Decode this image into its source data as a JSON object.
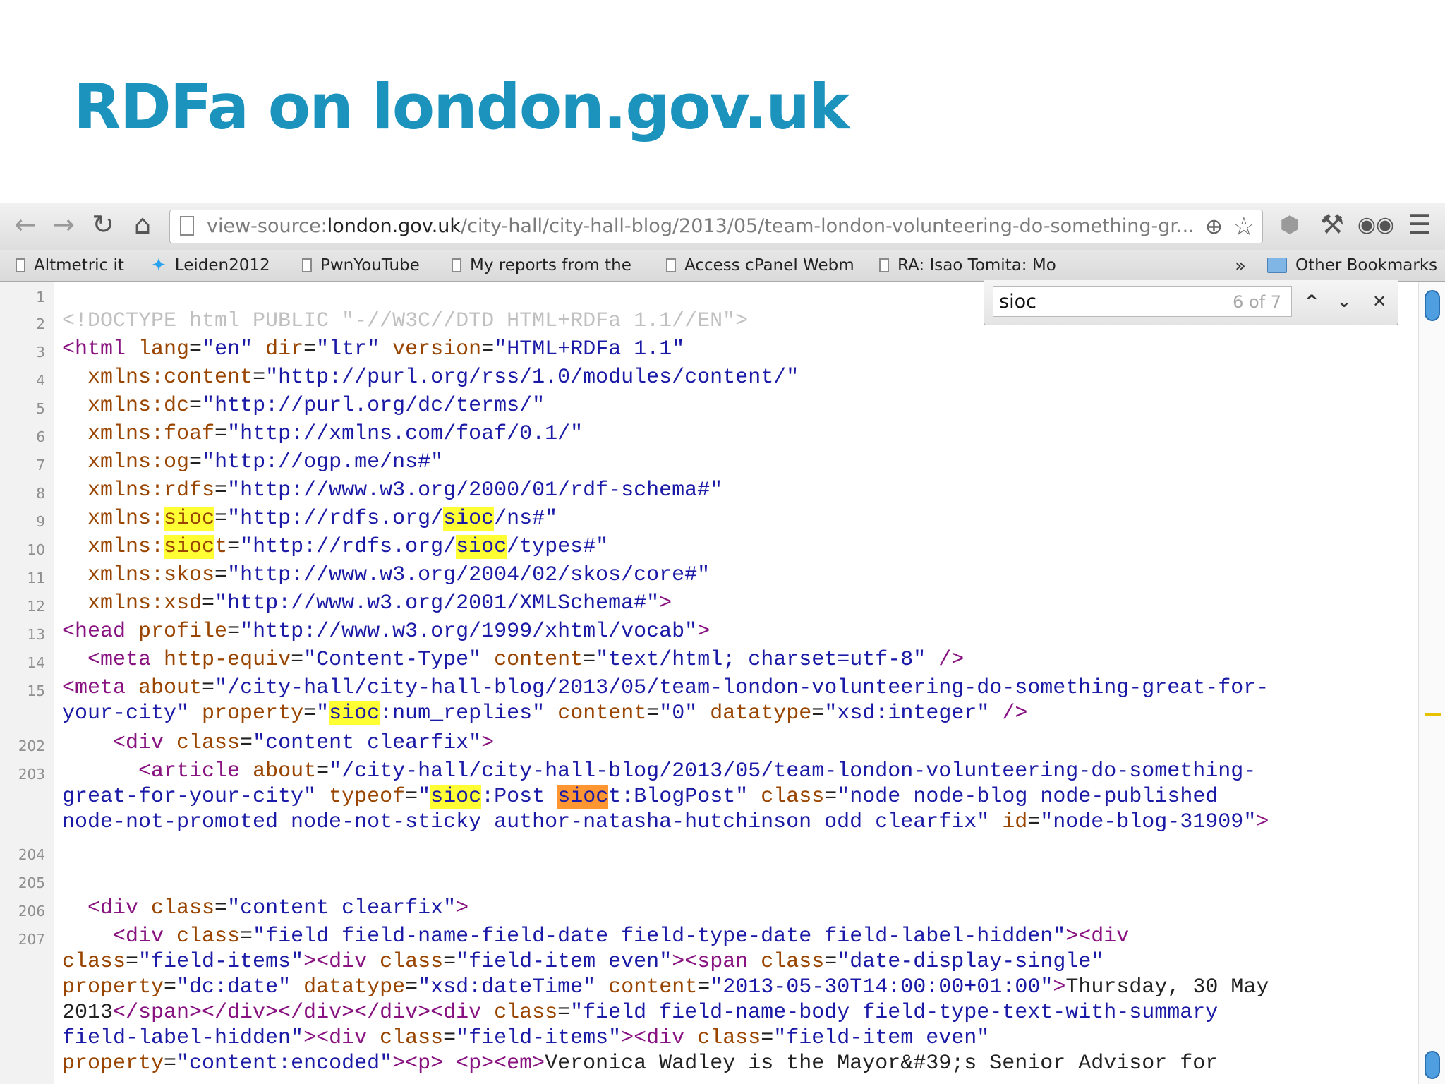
{
  "slide": {
    "title": "RDFa on london.gov.uk"
  },
  "toolbar": {
    "url_prefix": "view-source:",
    "url_host": "london.gov.uk",
    "url_path": "/city-hall/city-hall-blog/2013/05/team-london-volunteering-do-something-gr...",
    "icons": [
      "back-icon",
      "forward-icon",
      "reload-icon",
      "home-icon",
      "page-icon",
      "zoom-icon",
      "star-icon",
      "extension-icon",
      "wrench-icon",
      "incognito-icon",
      "menu-icon"
    ]
  },
  "bookmarks": {
    "items": [
      {
        "label": "Altmetric it",
        "icon": "page-icon"
      },
      {
        "label": "Leiden2012",
        "icon": "twitter-bird-icon"
      },
      {
        "label": "PwnYouTube",
        "icon": "page-icon"
      },
      {
        "label": "My reports from the",
        "icon": "page-icon"
      },
      {
        "label": "Access cPanel Webm",
        "icon": "page-icon"
      },
      {
        "label": "RA: Isao Tomita: Mo",
        "icon": "page-icon"
      }
    ],
    "overflow": "»",
    "other": "Other Bookmarks"
  },
  "find": {
    "query": "sioc",
    "count": "6 of 7",
    "prev": "^",
    "next": "⌄",
    "close": "✕"
  },
  "gutter": {
    "lines": [
      "1",
      "2",
      "3",
      "4",
      "5",
      "6",
      "7",
      "8",
      "9",
      "10",
      "11",
      "12",
      "13",
      "14",
      "15",
      "202",
      "203",
      "204",
      "205",
      "206",
      "207"
    ]
  },
  "colors": {
    "title": "#1b93bd",
    "tag": "#881280",
    "attr": "#994500",
    "value": "#1a1aa6",
    "match": "#ffff33",
    "current_match": "#ff9632"
  }
}
